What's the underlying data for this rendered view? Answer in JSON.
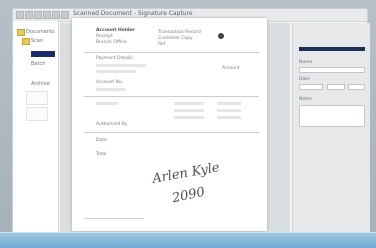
{
  "window": {
    "title": "Scanned Document - Signature Capture"
  },
  "sidebar": {
    "items": [
      {
        "label": "Documents"
      },
      {
        "label": "Scan"
      },
      {
        "label": "Batch"
      },
      {
        "label": "Archive"
      }
    ]
  },
  "document": {
    "header_left": [
      "Account Holder",
      "Receipt",
      "Branch Office"
    ],
    "header_right": [
      "Transaction Record",
      "Customer Copy",
      "Ref"
    ],
    "lines": [
      "Payment Details",
      "Amount",
      "Account No.",
      "Authorized By",
      "Date",
      "Total"
    ],
    "signature_1": "Arlen Kyle",
    "signature_2": "2090"
  },
  "panel": {
    "field_1_label": "Name",
    "field_2_label": "Date",
    "field_3_label": "Notes"
  }
}
